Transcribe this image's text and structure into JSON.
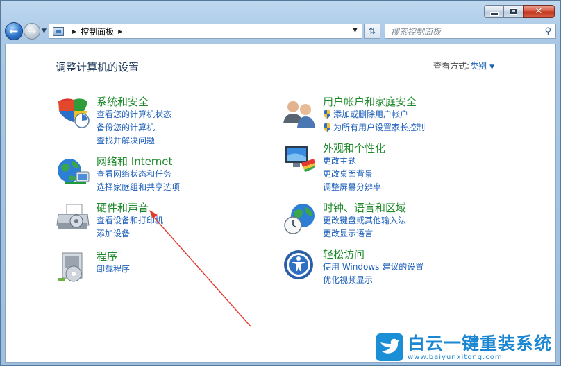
{
  "window": {
    "minimize": "",
    "maximize": "",
    "close": "✕"
  },
  "nav": {
    "breadcrumb": "控制面板",
    "search_placeholder": "搜索控制面板"
  },
  "header": {
    "title": "调整计算机的设置",
    "view_by_label": "查看方式:",
    "view_by_value": "类别"
  },
  "categories": [
    {
      "title": "系统和安全",
      "links": [
        "查看您的计算机状态",
        "备份您的计算机",
        "查找并解决问题"
      ]
    },
    {
      "title": "网络和 Internet",
      "links": [
        "查看网络状态和任务",
        "选择家庭组和共享选项"
      ]
    },
    {
      "title": "硬件和声音",
      "links": [
        "查看设备和打印机",
        "添加设备"
      ]
    },
    {
      "title": "程序",
      "links": [
        "卸载程序"
      ]
    },
    {
      "title": "用户帐户和家庭安全",
      "links": [
        "添加或删除用户帐户",
        "为所有用户设置家长控制"
      ]
    },
    {
      "title": "外观和个性化",
      "links": [
        "更改主题",
        "更改桌面背景",
        "调整屏幕分辨率"
      ]
    },
    {
      "title": "时钟、语言和区域",
      "links": [
        "更改键盘或其他输入法",
        "更改显示语言"
      ]
    },
    {
      "title": "轻松访问",
      "links": [
        "使用 Windows 建议的设置",
        "优化视频显示"
      ]
    }
  ],
  "watermark": {
    "name": "白云一键重装系统",
    "url": "www.baiyunxitong.com"
  },
  "colors": {
    "link": "#1d5fba",
    "category_title": "#1f8a2c",
    "heading": "#1e395b",
    "annotation_arrow": "#e23b2e"
  }
}
